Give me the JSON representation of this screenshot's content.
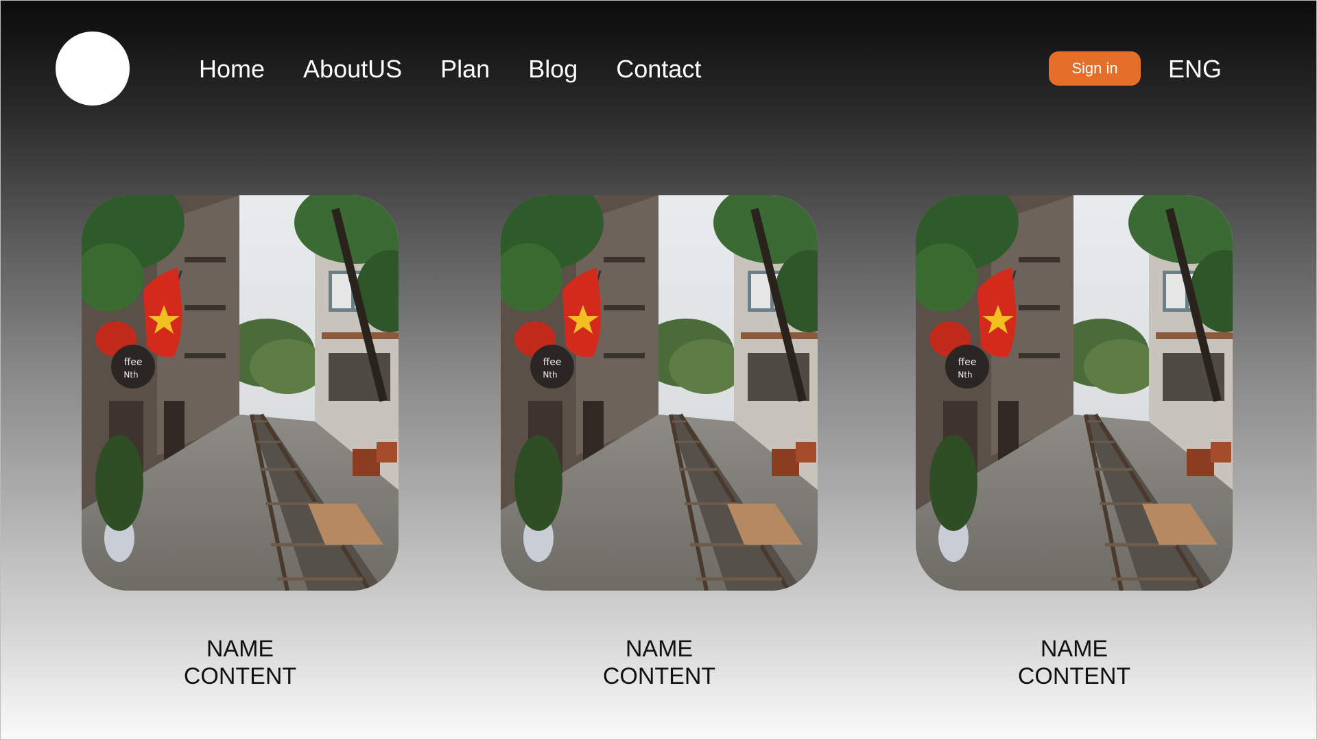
{
  "nav": {
    "items": [
      "Home",
      "AboutUS",
      "Plan",
      "Blog",
      "Contact"
    ]
  },
  "header": {
    "sign_in_label": "Sign in",
    "language": "ENG"
  },
  "colors": {
    "accent": "#e36f2a",
    "flag_red": "#d42a1c",
    "flag_star": "#f2c021"
  },
  "cards": [
    {
      "name": "NAME",
      "content": "CONTENT"
    },
    {
      "name": "NAME",
      "content": "CONTENT"
    },
    {
      "name": "NAME",
      "content": "CONTENT"
    }
  ]
}
